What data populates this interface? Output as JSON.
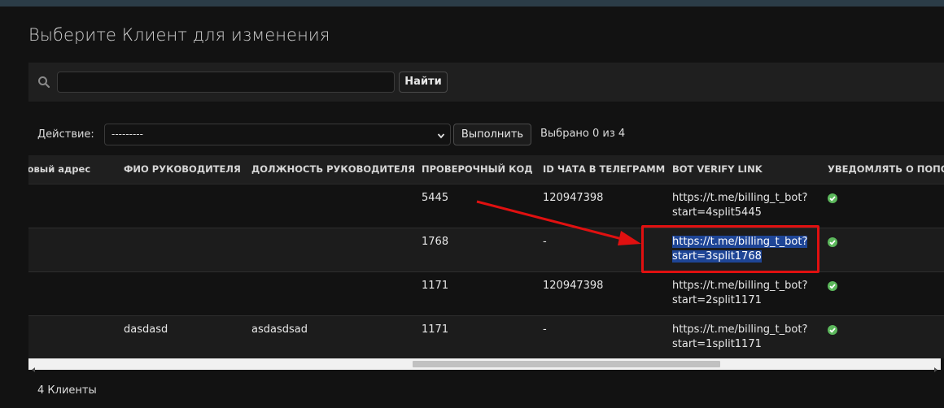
{
  "page": {
    "title": "Выберите Клиент для изменения"
  },
  "search": {
    "value": "",
    "button_label": "Найти"
  },
  "actions": {
    "label": "Действие:",
    "selected": "---------",
    "run_label": "Выполнить",
    "selection_count": "Выбрано 0 из 4"
  },
  "table": {
    "headers": [
      "нтовый адрес",
      "ФИО руководителя",
      "Должность руководителя",
      "Проверочный код",
      "ID чата в телеграмм",
      "Bot verify link",
      "Уведомлять о попол"
    ],
    "rows": [
      {
        "email": "",
        "head_name": "",
        "head_position": "",
        "code": "5445",
        "chat_id": "120947398",
        "link": "https://t.me/billing_t_bot?\nstart=4split5445",
        "notify": true
      },
      {
        "email": "",
        "head_name": "",
        "head_position": "",
        "code": "1768",
        "chat_id": "-",
        "link": "https://t.me/billing_t_bot?\nstart=3split1768",
        "notify": true
      },
      {
        "email": "",
        "head_name": "",
        "head_position": "",
        "code": "1171",
        "chat_id": "120947398",
        "link": "https://t.me/billing_t_bot?\nstart=2split1171",
        "notify": true
      },
      {
        "email": "",
        "head_name": "dasdasd",
        "head_position": "asdasdsad",
        "code": "1171",
        "chat_id": "-",
        "link": "https://t.me/billing_t_bot?\nstart=1split1171",
        "notify": true
      }
    ]
  },
  "footer": {
    "count": "4 Клиенты"
  },
  "colors": {
    "accent_check": "#5cb85c",
    "annotation": "#e01010",
    "selection": "#1e4596"
  },
  "icons": {
    "search": "search-icon",
    "check": "check-circle-icon",
    "chevron": "chevron-down-icon"
  }
}
